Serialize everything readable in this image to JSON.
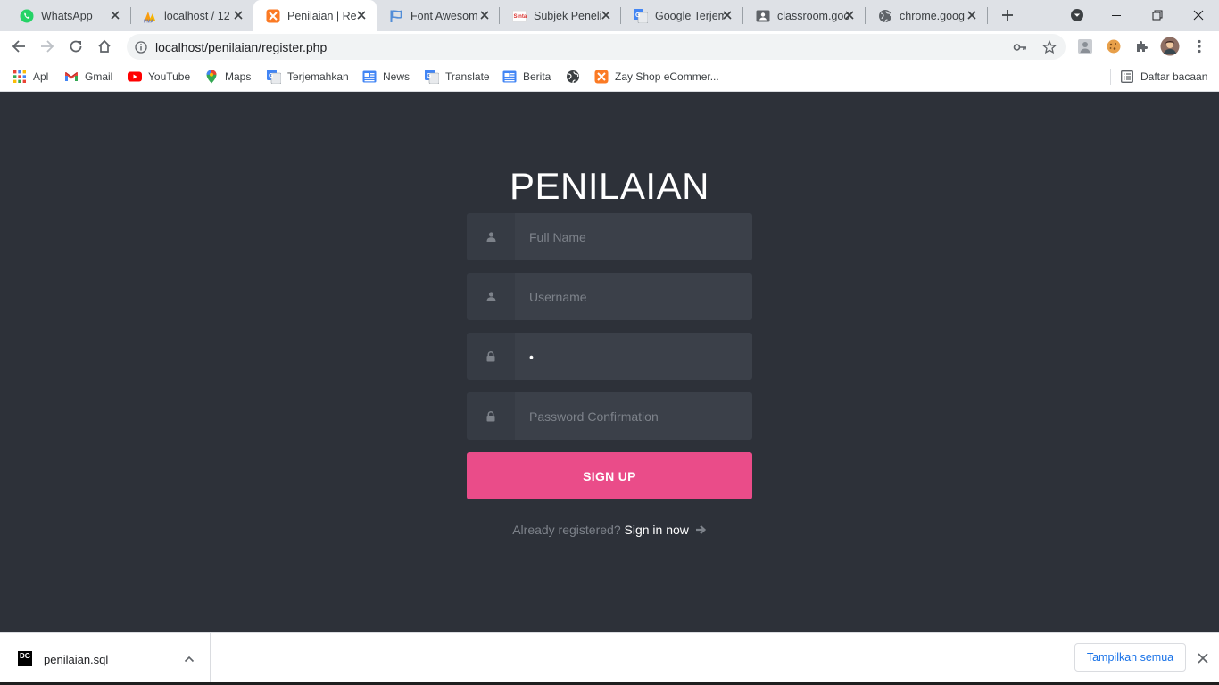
{
  "browser": {
    "tabs": [
      {
        "title": "WhatsApp",
        "icon": "whatsapp-icon",
        "active": false
      },
      {
        "title": "localhost / 12",
        "icon": "phpmyadmin-icon",
        "active": false
      },
      {
        "title": "Penilaian | Re",
        "icon": "xampp-icon",
        "active": true
      },
      {
        "title": "Font Awesom",
        "icon": "font-awesome-flag-icon",
        "active": false
      },
      {
        "title": "Subjek Peneli",
        "icon": "scholar-icon",
        "active": false
      },
      {
        "title": "Google Terjem",
        "icon": "google-translate-icon",
        "active": false
      },
      {
        "title": "classroom.goo",
        "icon": "classroom-icon",
        "active": false
      },
      {
        "title": "chrome.goog",
        "icon": "globe-icon",
        "active": false
      }
    ],
    "url": "localhost/penilaian/register.php",
    "bookmarks": [
      {
        "label": "Apl",
        "icon": "apps-grid-icon"
      },
      {
        "label": "Gmail",
        "icon": "gmail-icon"
      },
      {
        "label": "YouTube",
        "icon": "youtube-icon"
      },
      {
        "label": "Maps",
        "icon": "maps-pin-icon"
      },
      {
        "label": "Terjemahkan",
        "icon": "google-translate-icon"
      },
      {
        "label": "News",
        "icon": "google-news-icon"
      },
      {
        "label": "Translate",
        "icon": "google-translate-icon"
      },
      {
        "label": "Berita",
        "icon": "google-news-icon"
      },
      {
        "label": "",
        "icon": "globe-icon"
      },
      {
        "label": "Zay Shop eCommer...",
        "icon": "xampp-icon"
      }
    ],
    "reading_list": "Daftar bacaan"
  },
  "page": {
    "title": "PENILAIAN",
    "full_name_placeholder": "Full Name",
    "username_placeholder": "Username",
    "password_value": "•",
    "password_confirmation_placeholder": "Password Confirmation",
    "signup_label": "SIGN UP",
    "already_registered": "Already registered?",
    "signin_link": "Sign in now"
  },
  "downloads": {
    "file_name": "penilaian.sql",
    "file_icon_text": "DG",
    "show_all_label": "Tampilkan semua"
  },
  "colors": {
    "page_background": "#2d3139",
    "signup_button": "#ea4c89",
    "input_background": "#3b4049"
  }
}
